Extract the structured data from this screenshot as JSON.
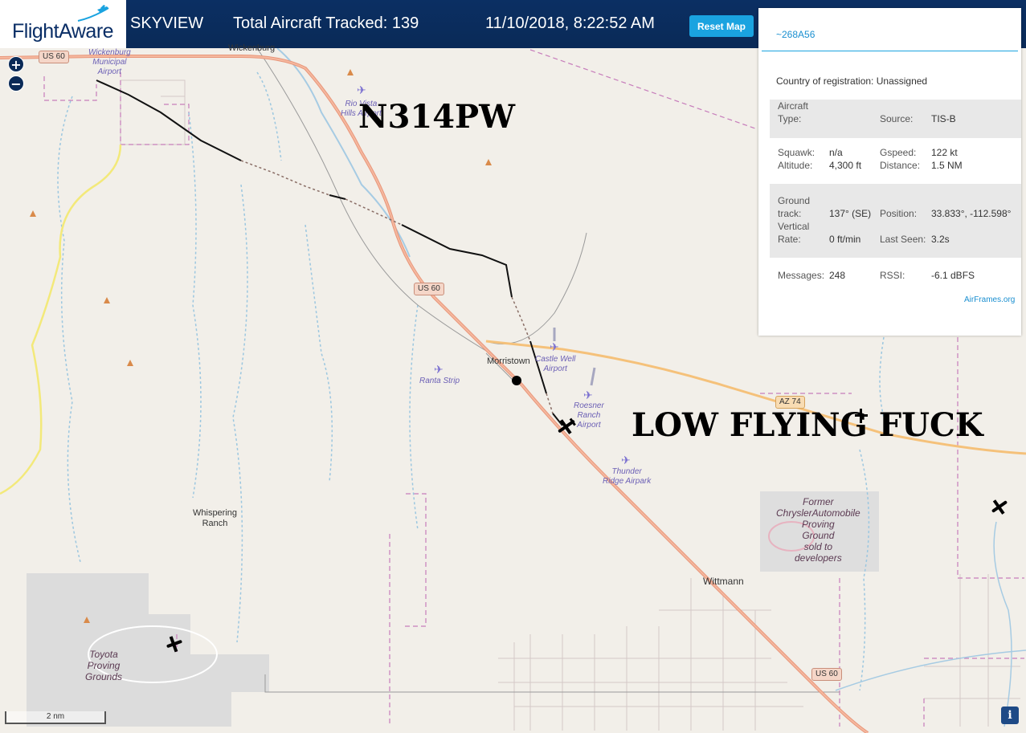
{
  "header": {
    "logo": "FlightAware",
    "app_name": "SKYVIEW",
    "total_label": "Total Aircraft Tracked: 139",
    "datetime": "11/10/2018, 8:22:52 AM",
    "reset_label": "Reset Map"
  },
  "zoom": {
    "in": "+",
    "out": "−"
  },
  "map": {
    "places": {
      "wickenburg": "Wickenburg",
      "morristown": "Morristown",
      "whispering_ranch": "Whispering\nRanch",
      "wittmann": "Wittmann"
    },
    "airports": {
      "wickenburg": "Wickenburg\nMunicipal\nAirport",
      "rio_vista": "Rio Vista\nHills Airport",
      "castle_well": "Castle Well\nAirport",
      "ranta": "Ranta Strip",
      "roesner": "Roesner\nRanch\nAirport",
      "thunder_ridge": "Thunder\nRidge Airpark"
    },
    "areas": {
      "chrysler": "Former\nChryslerAutomobile\nProving\nGround\nsold to\ndevelopers",
      "toyota": "Toyota\nProving\nGrounds"
    },
    "shields": {
      "us60_nw": "US 60",
      "us60_mid": "US 60",
      "us60_se": "US 60",
      "az74": "AZ 74"
    },
    "scale": "2 nm",
    "info": "i"
  },
  "annotations": {
    "tail": "N314PW",
    "caption": "LOW FLYING FUCK"
  },
  "panel": {
    "title": "~268A56",
    "country_label": "Country of registration:",
    "country_value": "Unassigned",
    "aircraft_type_label": "Aircraft\nType:",
    "aircraft_type_value": "",
    "source_label": "Source:",
    "source_value": "TIS-B",
    "squawk_label": "Squawk:",
    "squawk_value": "n/a",
    "gspeed_label": "Gspeed:",
    "gspeed_value": "122 kt",
    "altitude_label": "Altitude:",
    "altitude_value": "4,300 ft",
    "distance_label": "Distance:",
    "distance_value": "1.5 NM",
    "track_label": "Ground\ntrack:",
    "track_value": "137° (SE)",
    "position_label": "Position:",
    "position_value": "33.833°, -112.598°",
    "vrate_label": "Vertical\nRate:",
    "vrate_value": "0 ft/min",
    "lastseen_label": "Last Seen:",
    "lastseen_value": "3.2s",
    "messages_label": "Messages:",
    "messages_value": "248",
    "rssi_label": "RSSI:",
    "rssi_value": "-6.1 dBFS",
    "airframes": "AirFrames.org"
  },
  "colors": {
    "header_bg": "#0a2a57",
    "highway": "#e8967a",
    "az74": "#f5c17a",
    "accent": "#1aa3e0"
  }
}
